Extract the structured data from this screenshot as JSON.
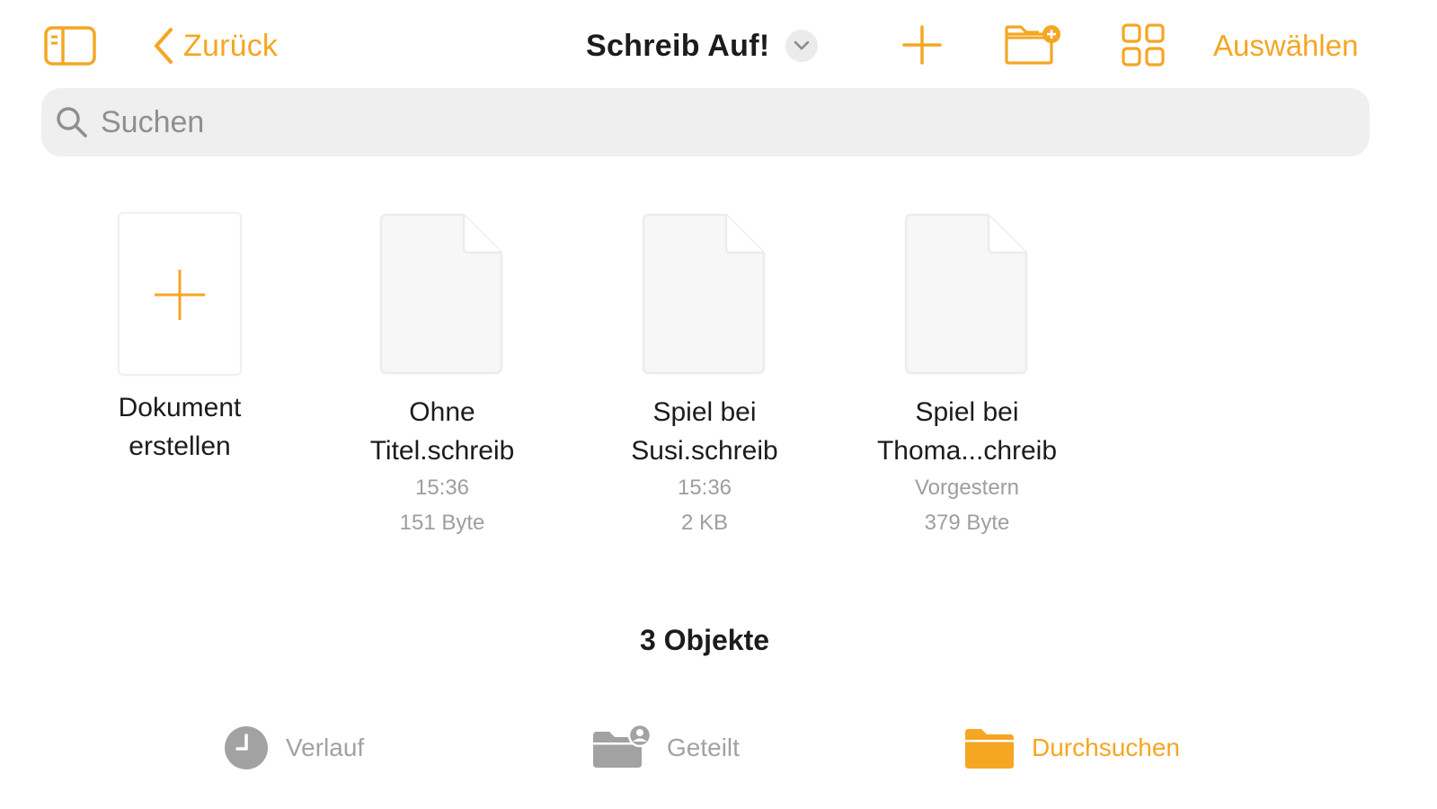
{
  "header": {
    "back_label": "Zurück",
    "title": "Schreib Auf!",
    "select_label": "Auswählen"
  },
  "search": {
    "placeholder": "Suchen",
    "value": ""
  },
  "files": {
    "create": {
      "line1": "Dokument",
      "line2": "erstellen"
    },
    "items": [
      {
        "line1": "Ohne",
        "line2": "Titel.schreib",
        "date": "15:36",
        "size": "151 Byte"
      },
      {
        "line1": "Spiel bei",
        "line2": "Susi.schreib",
        "date": "15:36",
        "size": "2 KB"
      },
      {
        "line1": "Spiel bei",
        "line2": "Thoma...chreib",
        "date": "Vorgestern",
        "size": "379 Byte"
      }
    ]
  },
  "footer": {
    "count": "3 Objekte"
  },
  "tabs": [
    {
      "label": "Verlauf",
      "icon": "clock-icon",
      "active": false
    },
    {
      "label": "Geteilt",
      "icon": "shared-folder-icon",
      "active": false
    },
    {
      "label": "Durchsuchen",
      "icon": "folder-icon",
      "active": true
    }
  ],
  "colors": {
    "accent": "#f5a623",
    "inactive": "#a2a2a2",
    "search_bg": "#efeff0"
  }
}
